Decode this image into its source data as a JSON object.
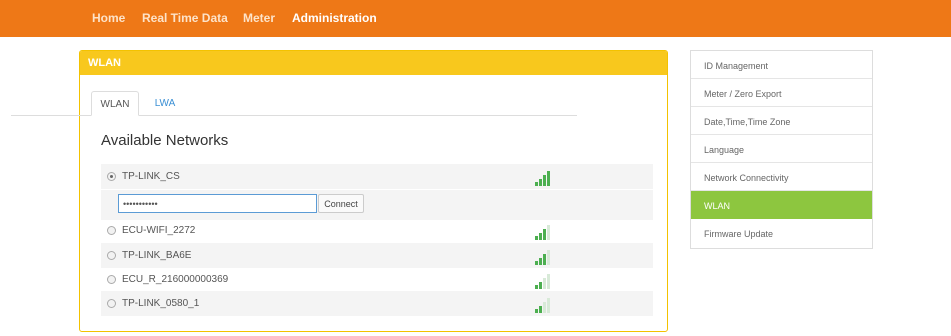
{
  "nav": {
    "items": [
      {
        "label": "Home",
        "active": false
      },
      {
        "label": "Real Time Data",
        "active": false
      },
      {
        "label": "Meter",
        "active": false
      },
      {
        "label": "Administration",
        "active": true
      }
    ]
  },
  "panel": {
    "title": "WLAN",
    "tabs": [
      {
        "label": "WLAN",
        "active": true
      },
      {
        "label": "LWA",
        "active": false
      }
    ],
    "section_title": "Available Networks",
    "password_value": "•••••••••••",
    "connect_label": "Connect",
    "networks": [
      {
        "ssid": "TP-LINK_CS",
        "selected": true,
        "signal_bars": 4
      },
      {
        "ssid": "ECU-WIFI_2272",
        "selected": false,
        "signal_bars": 3
      },
      {
        "ssid": "TP-LINK_BA6E",
        "selected": false,
        "signal_bars": 3
      },
      {
        "ssid": "ECU_R_216000000369",
        "selected": false,
        "signal_bars": 2
      },
      {
        "ssid": "TP-LINK_0580_1",
        "selected": false,
        "signal_bars": 2
      }
    ]
  },
  "sidebar": {
    "items": [
      {
        "label": "ID Management",
        "active": false
      },
      {
        "label": "Meter / Zero Export",
        "active": false
      },
      {
        "label": "Date,Time,Time Zone",
        "active": false
      },
      {
        "label": "Language",
        "active": false
      },
      {
        "label": "Network Connectivity",
        "active": false
      },
      {
        "label": "WLAN",
        "active": true
      },
      {
        "label": "Firmware Update",
        "active": false
      }
    ]
  },
  "colors": {
    "navbar": "#ee7817",
    "panel_header": "#f8c81d",
    "sidebar_active": "#8dc63f",
    "signal": "#4caf50",
    "link": "#3a8fd4"
  }
}
